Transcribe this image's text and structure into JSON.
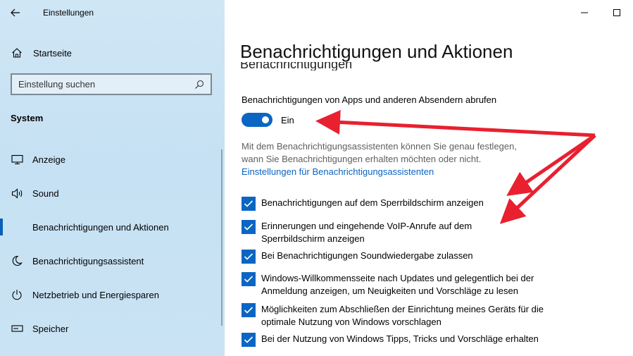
{
  "window": {
    "app_title": "Einstellungen",
    "controls": [
      "minimize",
      "maximize"
    ]
  },
  "sidebar": {
    "home_label": "Startseite",
    "search_placeholder": "Einstellung suchen",
    "section_title": "System",
    "items": [
      {
        "label": "Anzeige",
        "icon": "monitor-icon",
        "active": false
      },
      {
        "label": "Sound",
        "icon": "speaker-icon",
        "active": false
      },
      {
        "label": "Benachrichtigungen und Aktionen",
        "icon": "notification-icon",
        "active": true
      },
      {
        "label": "Benachrichtigungsassistent",
        "icon": "moon-icon",
        "active": false
      },
      {
        "label": "Netzbetrieb und Energiesparen",
        "icon": "power-icon",
        "active": false
      },
      {
        "label": "Speicher",
        "icon": "storage-icon",
        "active": false
      }
    ]
  },
  "main": {
    "title": "Benachrichtigungen und Aktionen",
    "section_heading": "Benachrichtigungen",
    "get_notifications_label": "Benachrichtigungen von Apps und anderen Absendern abrufen",
    "toggle_state": "Ein",
    "toggle_on": true,
    "assistant_description": "Mit dem Benachrichtigungsassistenten können Sie genau festlegen, wann Sie Benachrichtigungen erhalten möchten oder nicht.",
    "assistant_link": "Einstellungen für Benachrichtigungsassistenten",
    "checkboxes": [
      {
        "label": "Benachrichtigungen auf dem Sperrbildschirm anzeigen",
        "checked": true
      },
      {
        "label": "Erinnerungen und eingehende VoIP-Anrufe auf dem Sperrbildschirm anzeigen",
        "checked": true
      },
      {
        "label": "Bei Benachrichtigungen Soundwiedergabe zulassen",
        "checked": true
      },
      {
        "label": "Windows-Willkommensseite nach Updates und gelegentlich bei der Anmeldung anzeigen, um Neuigkeiten und Vorschläge zu lesen",
        "checked": true
      },
      {
        "label": "Möglichkeiten zum Abschließen der Einrichtung meines Geräts für die optimale Nutzung von Windows vorschlagen",
        "checked": true
      },
      {
        "label": "Bei der Nutzung von Windows Tipps, Tricks und Vorschläge erhalten",
        "checked": true
      }
    ]
  },
  "colors": {
    "accent": "#0b66c3",
    "link": "#0b63c1",
    "sidebar_bg": "#c6e1f3",
    "annotation_arrow": "#e8202f"
  }
}
